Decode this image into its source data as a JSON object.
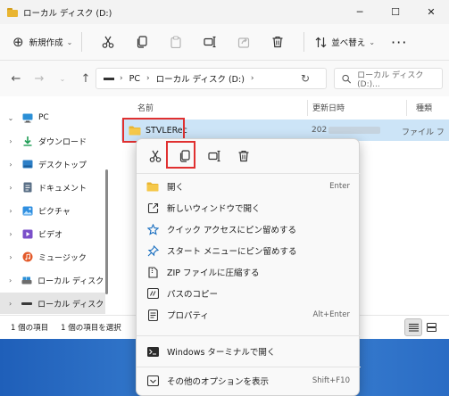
{
  "window": {
    "title": "ローカル ディスク (D:)",
    "controls": [
      "─",
      "☐",
      "✕"
    ]
  },
  "toolbar": {
    "new_label": "新規作成",
    "new_chevron": "⌄",
    "sort_label": "並べ替え",
    "sort_chevron": "⌄",
    "more_label": "···"
  },
  "nav": {
    "back": "←",
    "forward": "→",
    "up": "↑",
    "breadcrumb": [
      "PC",
      "ローカル ディスク (D:)"
    ],
    "separator": "›",
    "refresh": "↻",
    "search_placeholder": "ローカル ディスク (D:)..."
  },
  "sidebar": {
    "items": [
      {
        "label": "PC",
        "icon": "pc-icon",
        "chevron": "⌄"
      },
      {
        "label": "ダウンロード",
        "icon": "download-icon",
        "chevron": "›"
      },
      {
        "label": "デスクトップ",
        "icon": "desktop-icon",
        "chevron": "›"
      },
      {
        "label": "ドキュメント",
        "icon": "document-icon",
        "chevron": "›"
      },
      {
        "label": "ピクチャ",
        "icon": "pictures-icon",
        "chevron": "›"
      },
      {
        "label": "ビデオ",
        "icon": "video-icon",
        "chevron": "›"
      },
      {
        "label": "ミュージック",
        "icon": "music-icon",
        "chevron": "›"
      },
      {
        "label": "ローカル ディスク (",
        "icon": "local-disk-icon",
        "chevron": "›"
      },
      {
        "label": "ローカル ディスク (",
        "icon": "drive-icon",
        "chevron": "›",
        "selected": true
      }
    ]
  },
  "columns": {
    "name": "名前",
    "date": "更新日時",
    "type": "種類"
  },
  "file": {
    "name": "STVLERec",
    "date_prefix": "202",
    "type": "ファイル フ"
  },
  "status": {
    "count": "1 個の項目",
    "selected": "1 個の項目を選択"
  },
  "context_menu": {
    "top_actions": [
      {
        "name": "cut",
        "icon": "cut-icon"
      },
      {
        "name": "copy",
        "icon": "copy-icon",
        "highlighted": true
      },
      {
        "name": "rename",
        "icon": "rename-icon"
      },
      {
        "name": "delete",
        "icon": "trash-icon"
      }
    ],
    "items": [
      {
        "label": "開く",
        "shortcut": "Enter",
        "icon": "open-folder-icon"
      },
      {
        "label": "新しいウィンドウで開く",
        "shortcut": "",
        "icon": "new-window-icon"
      },
      {
        "label": "クイック アクセスにピン留めする",
        "shortcut": "",
        "icon": "star-icon"
      },
      {
        "label": "スタート メニューにピン留めする",
        "shortcut": "",
        "icon": "pin-icon"
      },
      {
        "label": "ZIP ファイルに圧縮する",
        "shortcut": "",
        "icon": "zip-icon"
      },
      {
        "label": "パスのコピー",
        "shortcut": "",
        "icon": "copy-path-icon"
      },
      {
        "label": "プロパティ",
        "shortcut": "Alt+Enter",
        "icon": "properties-icon"
      },
      {
        "label": "Windows ターミナルで開く",
        "shortcut": "",
        "icon": "terminal-icon"
      },
      {
        "label": "その他のオプションを表示",
        "shortcut": "Shift+F10",
        "icon": "more-options-icon"
      }
    ]
  },
  "colors": {
    "accent": "#0067c0",
    "selection": "#cce4f7",
    "highlight_box": "#e03030",
    "folder": "#e9b531"
  }
}
